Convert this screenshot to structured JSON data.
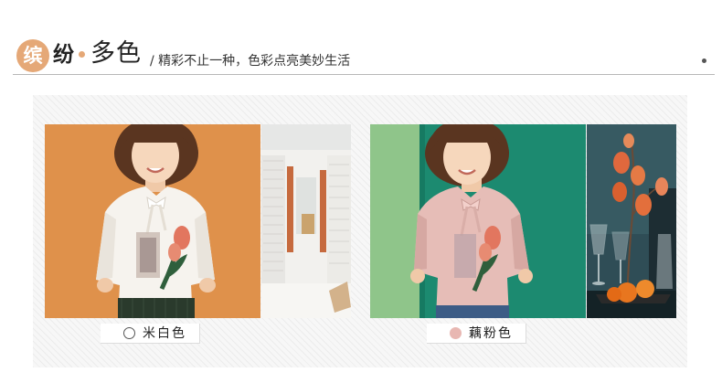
{
  "header": {
    "circle_char": "缤",
    "title_second_char": "纷",
    "title_rest": "多色",
    "subtitle": "/ 精彩不止一种，色彩点亮美妙生活"
  },
  "colors": {
    "accent": "#e5a877",
    "orange_backdrop": "#e2944f",
    "teal_backdrop": "#1c8a70",
    "pink_swatch": "#e8b7b2"
  },
  "products": [
    {
      "color_name": "米白色",
      "swatch_color": "#ffffff"
    },
    {
      "color_name": "藕粉色",
      "swatch_color": "#e8b7b2"
    }
  ]
}
